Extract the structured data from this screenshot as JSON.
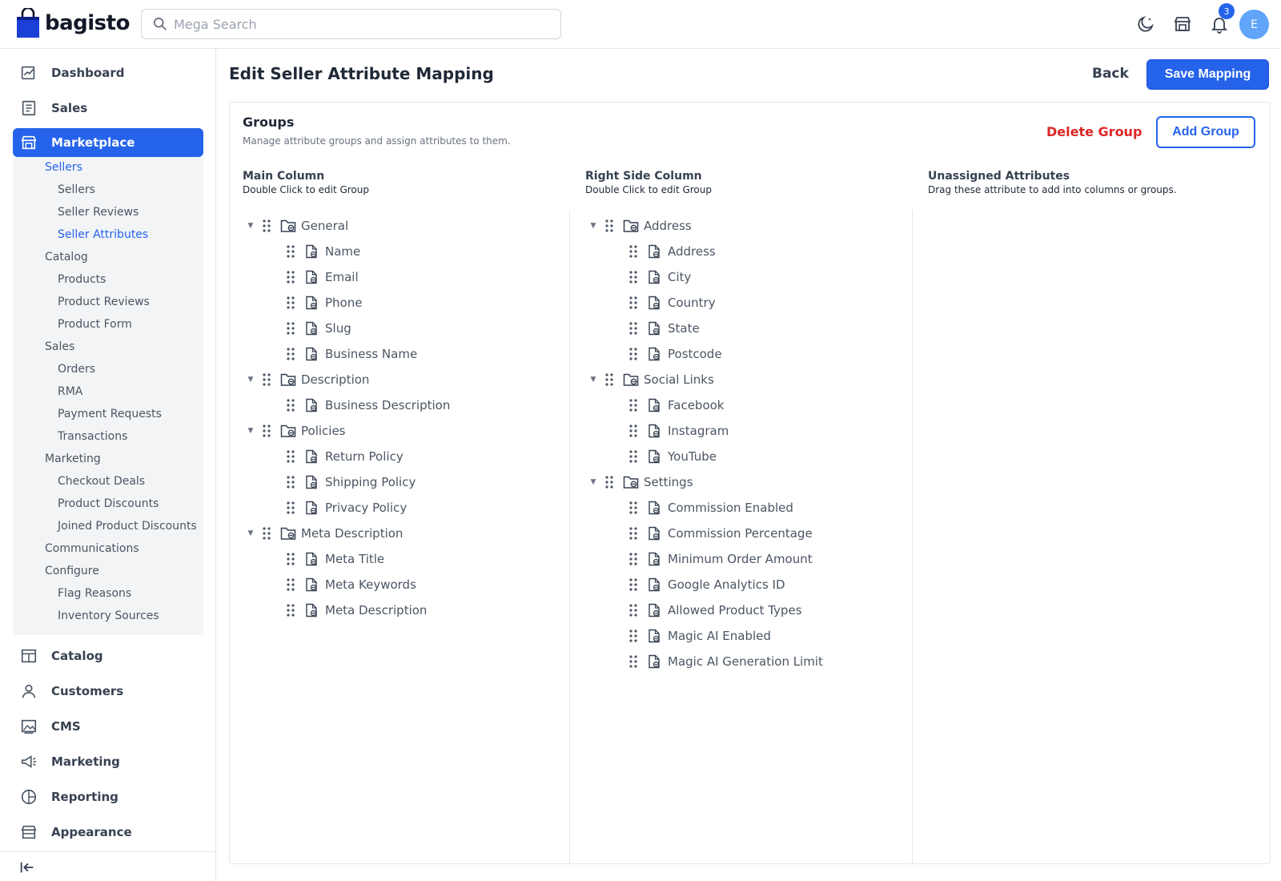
{
  "header": {
    "brand": "bagisto",
    "search_placeholder": "Mega Search",
    "notifications_count": "3",
    "avatar_initial": "E"
  },
  "sidebar": {
    "items": [
      {
        "label": "Dashboard",
        "icon": "dashboard-icon"
      },
      {
        "label": "Sales",
        "icon": "receipt-icon"
      },
      {
        "label": "Marketplace",
        "icon": "store-icon"
      },
      {
        "label": "Catalog",
        "icon": "catalog-icon"
      },
      {
        "label": "Customers",
        "icon": "user-icon"
      },
      {
        "label": "CMS",
        "icon": "image-icon"
      },
      {
        "label": "Marketing",
        "icon": "megaphone-icon"
      },
      {
        "label": "Reporting",
        "icon": "pie-chart-icon"
      },
      {
        "label": "Appearance",
        "icon": "layout-icon"
      }
    ],
    "marketplace_sub": [
      {
        "label": "Sellers",
        "level": 1
      },
      {
        "label": "Sellers",
        "level": 2
      },
      {
        "label": "Seller Reviews",
        "level": 2
      },
      {
        "label": "Seller Attributes",
        "level": 2
      },
      {
        "label": "Catalog",
        "level": 1
      },
      {
        "label": "Products",
        "level": 2
      },
      {
        "label": "Product Reviews",
        "level": 2
      },
      {
        "label": "Product Form",
        "level": 2
      },
      {
        "label": "Sales",
        "level": 1
      },
      {
        "label": "Orders",
        "level": 2
      },
      {
        "label": "RMA",
        "level": 2
      },
      {
        "label": "Payment Requests",
        "level": 2
      },
      {
        "label": "Transactions",
        "level": 2
      },
      {
        "label": "Marketing",
        "level": 1
      },
      {
        "label": "Checkout Deals",
        "level": 2
      },
      {
        "label": "Product Discounts",
        "level": 2
      },
      {
        "label": "Joined Product Discounts",
        "level": 2
      },
      {
        "label": "Communications",
        "level": 1
      },
      {
        "label": "Configure",
        "level": 1
      },
      {
        "label": "Flag Reasons",
        "level": 2
      },
      {
        "label": "Inventory Sources",
        "level": 2
      }
    ]
  },
  "page": {
    "title": "Edit Seller Attribute Mapping",
    "back_label": "Back",
    "save_label": "Save Mapping"
  },
  "groups": {
    "title": "Groups",
    "subtitle": "Manage attribute groups and assign attributes to them.",
    "delete_label": "Delete Group",
    "add_label": "Add Group"
  },
  "columns": {
    "main": {
      "title": "Main Column",
      "hint": "Double Click to edit Group",
      "groups": [
        {
          "name": "General",
          "attributes": [
            "Name",
            "Email",
            "Phone",
            "Slug",
            "Business Name"
          ]
        },
        {
          "name": "Description",
          "attributes": [
            "Business Description"
          ]
        },
        {
          "name": "Policies",
          "attributes": [
            "Return Policy",
            "Shipping Policy",
            "Privacy Policy"
          ]
        },
        {
          "name": "Meta Description",
          "attributes": [
            "Meta Title",
            "Meta Keywords",
            "Meta Description"
          ]
        }
      ]
    },
    "right": {
      "title": "Right Side Column",
      "hint": "Double Click to edit Group",
      "groups": [
        {
          "name": "Address",
          "attributes": [
            "Address",
            "City",
            "Country",
            "State",
            "Postcode"
          ]
        },
        {
          "name": "Social Links",
          "attributes": [
            "Facebook",
            "Instagram",
            "YouTube"
          ]
        },
        {
          "name": "Settings",
          "attributes": [
            "Commission Enabled",
            "Commission Percentage",
            "Minimum Order Amount",
            "Google Analytics ID",
            "Allowed Product Types",
            "Magic AI Enabled",
            "Magic AI Generation Limit"
          ]
        }
      ]
    },
    "unassigned": {
      "title": "Unassigned Attributes",
      "hint": "Drag these attribute to add into columns or groups."
    }
  },
  "colors": {
    "accent": "#2563eb",
    "danger": "#dc2626"
  }
}
